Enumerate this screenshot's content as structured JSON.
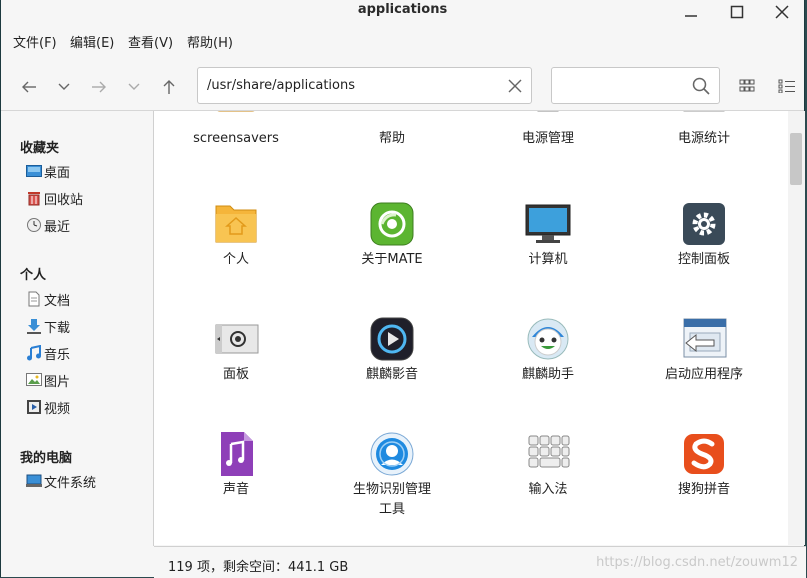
{
  "window": {
    "title": "applications"
  },
  "menu": [
    {
      "label": "文件(F)"
    },
    {
      "label": "编辑(E)"
    },
    {
      "label": "查看(V)"
    },
    {
      "label": "帮助(H)"
    }
  ],
  "location": {
    "path": "/usr/share/applications"
  },
  "sidebar": {
    "sections": [
      {
        "title": "收藏夹",
        "items": [
          {
            "label": "桌面",
            "icon": "desktop-icon"
          },
          {
            "label": "回收站",
            "icon": "trash-icon"
          },
          {
            "label": "最近",
            "icon": "recent-clock-icon"
          }
        ]
      },
      {
        "title": "个人",
        "items": [
          {
            "label": "文档",
            "icon": "document-icon"
          },
          {
            "label": "下载",
            "icon": "download-icon"
          },
          {
            "label": "音乐",
            "icon": "music-icon"
          },
          {
            "label": "图片",
            "icon": "picture-icon"
          },
          {
            "label": "视频",
            "icon": "video-icon"
          }
        ]
      },
      {
        "title": "我的电脑",
        "items": [
          {
            "label": "文件系统",
            "icon": "filesystem-icon"
          }
        ]
      }
    ]
  },
  "files": [
    {
      "label": "screensavers",
      "icon": "folder-icon"
    },
    {
      "label": "帮助",
      "icon": "help-icon"
    },
    {
      "label": "电源管理",
      "icon": "power-manager-icon"
    },
    {
      "label": "电源统计",
      "icon": "power-statistics-icon"
    },
    {
      "label": "个人",
      "icon": "home-folder-icon"
    },
    {
      "label": "关于MATE",
      "icon": "about-mate-icon"
    },
    {
      "label": "计算机",
      "icon": "computer-icon"
    },
    {
      "label": "控制面板",
      "icon": "control-panel-icon"
    },
    {
      "label": "面板",
      "icon": "panel-icon"
    },
    {
      "label": "麒麟影音",
      "icon": "media-player-icon"
    },
    {
      "label": "麒麟助手",
      "icon": "assistant-icon"
    },
    {
      "label": "启动应用程序",
      "icon": "startup-apps-icon"
    },
    {
      "label": "声音",
      "icon": "sound-icon"
    },
    {
      "label": "生物识别管理\n工具",
      "icon": "biometric-icon"
    },
    {
      "label": "输入法",
      "icon": "input-method-icon"
    },
    {
      "label": "搜狗拼音",
      "icon": "sogou-pinyin-icon"
    }
  ],
  "status": {
    "text": "119 项，剩余空间：441.1 GB"
  },
  "watermark": "https://blog.csdn.net/zouwm12"
}
